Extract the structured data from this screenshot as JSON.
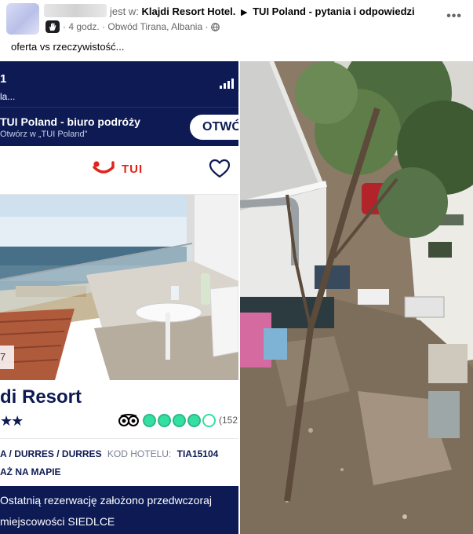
{
  "post": {
    "posted_in_prefix": "jest w:",
    "group_place": "Klajdi Resort Hotel.",
    "arrow": "▶",
    "group_name": "TUI Poland - pytania i odpowiedzi",
    "time": "4 godz.",
    "location": "Obwód Tirana, Albania",
    "dot": "·",
    "more": "•••",
    "caption": "oferta vs rzeczywistość..."
  },
  "left_photo": {
    "status_number": "1",
    "status_sub": "la...",
    "banner_title": "TUI Poland - biuro podróży",
    "banner_sub": "Otwórz w „TUI Poland\"",
    "open_button": "OTWÓ",
    "logo_word": "TUI",
    "photo_counter": "7",
    "hotel_name": "di Resort",
    "stars": "★★",
    "rating_bubbles": 4,
    "rating_total": 5,
    "review_count": "(152",
    "location": "A / DURRES / DURRES",
    "hotel_code_label": "KOD HOTELU:",
    "hotel_code": "TIA15104",
    "map_link": "AŻ NA MAPIE",
    "booking_line1": "Ostatnią rezerwację założono przedwczoraj",
    "booking_line2": "miejscowości SIEDLCE"
  },
  "colors": {
    "tui_navy": "#0d1a54",
    "tui_red": "#e2231a",
    "tripadvisor_green": "#34e0a1"
  },
  "icons": {
    "more": "ellipsis-icon",
    "group_badge": "hand-icon",
    "privacy": "globe-icon",
    "favorite": "heart-icon",
    "signal": "signal-icon"
  }
}
